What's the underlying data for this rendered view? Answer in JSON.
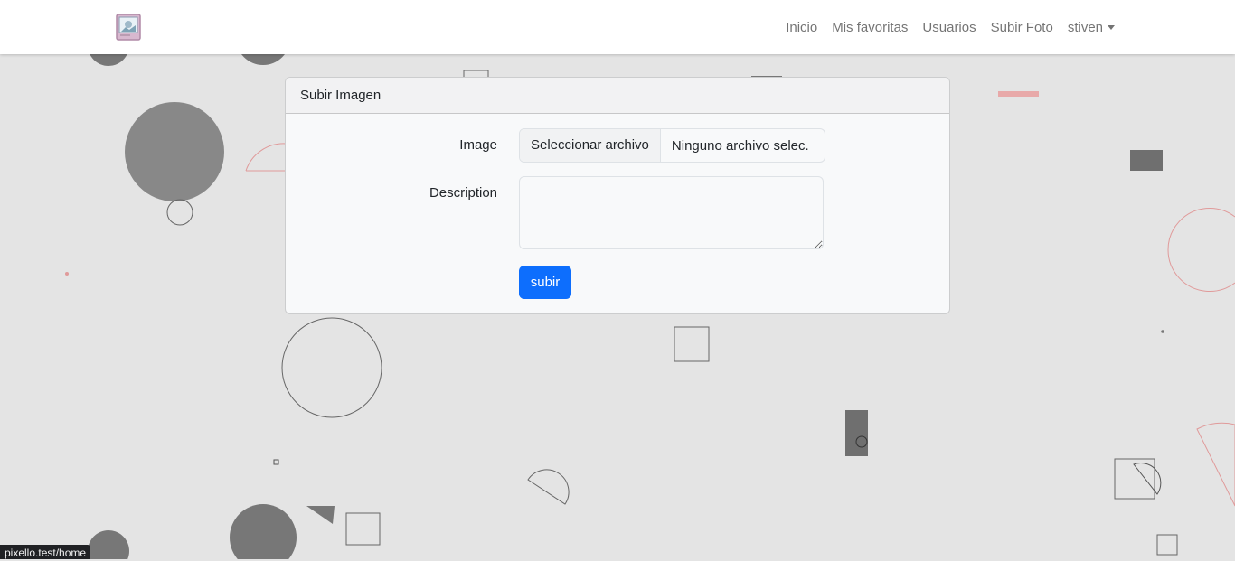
{
  "navbar": {
    "logo_icon": "photo-album-logo-icon",
    "links": [
      "Inicio",
      "Mis favoritas",
      "Usuarios",
      "Subir Foto"
    ],
    "user": "stiven"
  },
  "card": {
    "title": "Subir Imagen",
    "image_label": "Image",
    "file_button": "Seleccionar archivo",
    "file_status": "Ninguno archivo selec.",
    "description_label": "Description",
    "description_value": "",
    "submit_label": "subir"
  },
  "status_bar": {
    "url": "pixello.test/home"
  },
  "colors": {
    "accent": "#0d6efd",
    "background": "#e4e4e4",
    "shape_fill": "#777777",
    "shape_accent": "#e8a0a0"
  }
}
